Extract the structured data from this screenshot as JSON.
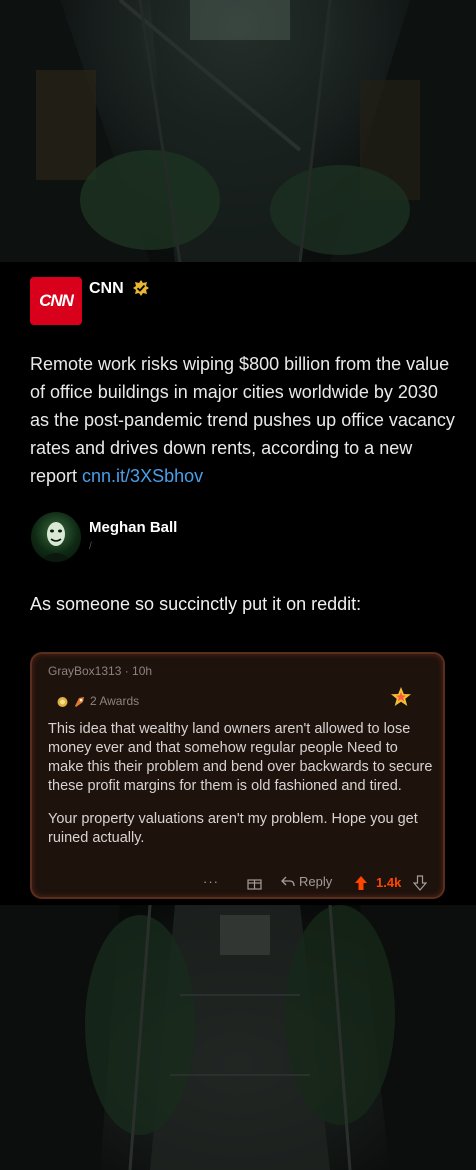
{
  "tweet": {
    "account_name": "CNN",
    "avatar_logo_text": "CNN",
    "text": "Remote work risks wiping $800 billion from the value of office buildings in major cities worldwide by 2030 as the post-pandemic trend pushes up office vacancy rates and drives down rents, according to a new report ",
    "link": "cnn.it/3XSbhov",
    "brand_color": "#d9001b",
    "verified_color": "#e8b630"
  },
  "reply": {
    "author_name": "Meghan Ball",
    "author_sub": "/",
    "text": "As someone so succinctly put it on reddit:"
  },
  "reddit": {
    "meta": "GrayBox1313 · 10h",
    "awards": "2 Awards",
    "body_p1": "This idea that wealthy land owners aren't allowed to lose money ever and that somehow regular people Need to make this their problem and bend over backwards to secure these profit margins for them is old fashioned and tired.",
    "body_p2": "Your property valuations aren't my problem. Hope you get ruined actually.",
    "more": "···",
    "reply_label": "Reply",
    "score": "1.4k",
    "accent": "#ff4500"
  }
}
